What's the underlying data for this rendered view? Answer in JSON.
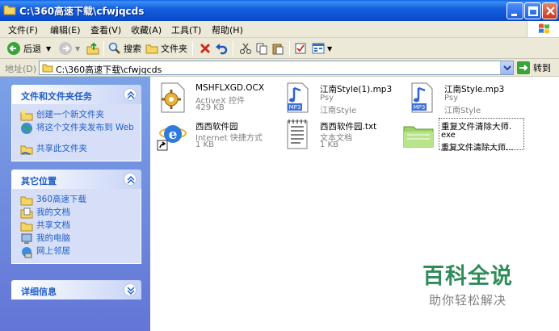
{
  "window": {
    "title": "C:\\360高速下载\\cfwjqcds"
  },
  "menu": [
    "文件(F)",
    "编辑(E)",
    "查看(V)",
    "收藏(A)",
    "工具(T)",
    "帮助(H)"
  ],
  "toolbar": {
    "back": "后退",
    "search": "搜索",
    "folders": "文件夹"
  },
  "address": {
    "label": "地址(D)",
    "path": "C:\\360高速下载\\cfwjqcds",
    "go": "转到"
  },
  "tasks_panel": {
    "title": "文件和文件夹任务",
    "items": [
      "创建一个新文件夹",
      "将这个文件夹发布到 Web",
      "共享此文件夹"
    ]
  },
  "places_panel": {
    "title": "其它位置",
    "items": [
      "360高速下载",
      "我的文档",
      "共享文档",
      "我的电脑",
      "网上邻居"
    ]
  },
  "details_panel": {
    "title": "详细信息"
  },
  "files": [
    {
      "name": "MSHFLXGD.OCX",
      "line1": "ActiveX 控件",
      "line2": "429 KB",
      "icon": "activex-icon"
    },
    {
      "name": "江南Style(1).mp3",
      "line1": "Psy",
      "line2": "江南Style",
      "icon": "mp3-icon"
    },
    {
      "name": "江南Style.mp3",
      "line1": "Psy",
      "line2": "江南Style",
      "icon": "mp3-icon"
    },
    {
      "name": "西西软件园",
      "line1": "Internet 快捷方式",
      "line2": "1 KB",
      "icon": "ie-shortcut-icon"
    },
    {
      "name": "西西软件园.txt",
      "line1": "文本文档",
      "line2": "1 KB",
      "icon": "text-file-icon"
    },
    {
      "name": "重复文件清除大师.",
      "line1": "exe",
      "line2": "重复文件清除大师...",
      "icon": "exe-folder-icon"
    }
  ],
  "watermark": {
    "brand": "百科全说",
    "slogan": "助你轻松解决"
  },
  "colors": {
    "titlebar": "#0b4fd0",
    "taskpane": "#7ba2e7",
    "link": "#215dc6",
    "watermark": "#2f8c5a"
  }
}
